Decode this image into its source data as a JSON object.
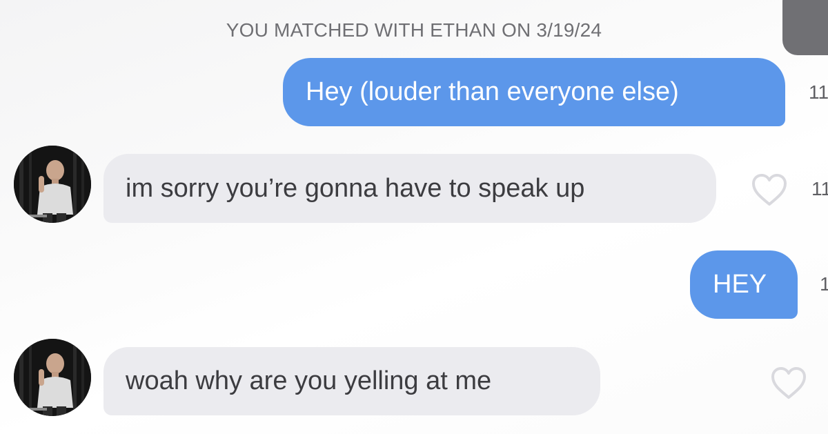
{
  "chat": {
    "match_banner": "YOU MATCHED WITH ETHAN ON 3/19/24",
    "messages": [
      {
        "direction": "sent",
        "text": "Hey (louder than everyone else)",
        "time_partial": "11"
      },
      {
        "direction": "received",
        "sender": "Ethan",
        "text": "im sorry you’re gonna have to speak up",
        "time_partial": "11",
        "liked": false
      },
      {
        "direction": "sent",
        "text": "HEY",
        "time_partial": "1"
      },
      {
        "direction": "received",
        "sender": "Ethan",
        "text": "woah why are you yelling at me",
        "liked": false
      }
    ]
  },
  "colors": {
    "sent_bubble": "#5c97ea",
    "received_bubble": "#ebebef",
    "banner_text": "#6f6f73",
    "heart_outline": "#d9d9de"
  },
  "icons": {
    "like": "heart-outline-icon",
    "avatar": "profile-photo"
  }
}
